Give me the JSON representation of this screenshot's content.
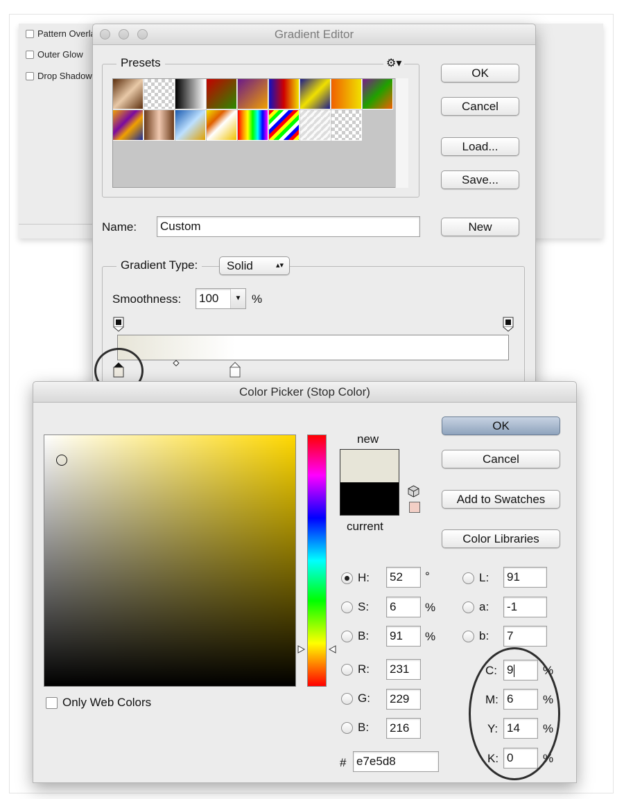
{
  "layer_styles": {
    "items": [
      {
        "label": "Pattern Overlay",
        "checked": false
      },
      {
        "label": "Outer Glow",
        "checked": false
      },
      {
        "label": "Drop Shadow",
        "checked": false
      }
    ]
  },
  "gradient_editor": {
    "title": "Gradient Editor",
    "presets_label": "Presets",
    "buttons": {
      "ok": "OK",
      "cancel": "Cancel",
      "load": "Load...",
      "save": "Save...",
      "new": "New"
    },
    "name_label": "Name:",
    "name_value": "Custom",
    "gradient_type_label": "Gradient Type:",
    "gradient_type_value": "Solid",
    "smoothness_label": "Smoothness:",
    "smoothness_value": "100",
    "smoothness_unit": "%",
    "preset_swatches": [
      "linear-gradient(135deg,#5a2d0c,#e8c9a8 50%,#5a2d0c)",
      "checker-fade",
      "linear-gradient(90deg,#000,#fff)",
      "linear-gradient(135deg,#c40000,#2a8a00)",
      "linear-gradient(135deg,#6a1a8a,#f0a000)",
      "linear-gradient(90deg,#1010c0,#d00000,#f0e000)",
      "linear-gradient(135deg,#1a1a8a,#f0e000 50%,#1a1a8a)",
      "linear-gradient(90deg,#f06000,#f0e000)",
      "linear-gradient(135deg,#7a1a8a,#20a000 50%,#f06000)",
      "linear-gradient(135deg,#f0a000,#7a0aa0 40%,#f0a000 60%,#1a2a9a)",
      "linear-gradient(90deg,#6a3a1a,#f0c8b0 50%,#6a3a1a)",
      "linear-gradient(135deg,#1a5ab0,#bde0ff 50%,#e0a000)",
      "linear-gradient(135deg,#f0e000,#e06000 30%,#fff 50%,#f0c000)",
      "linear-gradient(90deg,#f00,#f80,#ff0,#0f0,#0ff,#00f,#f0f)",
      "repeating-linear-gradient(135deg,#f00 0 5px,#ff0 5px 10px,#0f0 10px 15px,#fff 15px 20px,#00f 20px 25px)",
      "checker-stripes",
      "checker"
    ]
  },
  "color_picker": {
    "title": "Color Picker (Stop Color)",
    "buttons": {
      "ok": "OK",
      "cancel": "Cancel",
      "add_to_swatches": "Add to Swatches",
      "color_libraries": "Color Libraries"
    },
    "new_label": "new",
    "current_label": "current",
    "new_color": "#e7e5d8",
    "current_color": "#000000",
    "hue_color": "#ffd800",
    "only_web_colors_label": "Only Web Colors",
    "fields": {
      "H": {
        "value": "52",
        "unit": "°"
      },
      "S": {
        "value": "6",
        "unit": "%"
      },
      "B": {
        "value": "91",
        "unit": "%"
      },
      "R": {
        "value": "231"
      },
      "G": {
        "value": "229"
      },
      "Bl": {
        "value": "216"
      },
      "L": {
        "value": "91"
      },
      "a": {
        "value": "-1"
      },
      "b": {
        "value": "7"
      },
      "C": {
        "value": "9",
        "unit": "%"
      },
      "M": {
        "value": "6",
        "unit": "%"
      },
      "Y": {
        "value": "14",
        "unit": "%"
      },
      "K": {
        "value": "0",
        "unit": "%"
      }
    },
    "labels": {
      "H": "H:",
      "S": "S:",
      "B": "B:",
      "R": "R:",
      "G": "G:",
      "Bl": "B:",
      "L": "L:",
      "a": "a:",
      "b": "b:",
      "C": "C:",
      "M": "M:",
      "Y": "Y:",
      "K": "K:"
    },
    "hex_label": "#",
    "hex_value": "e7e5d8"
  }
}
